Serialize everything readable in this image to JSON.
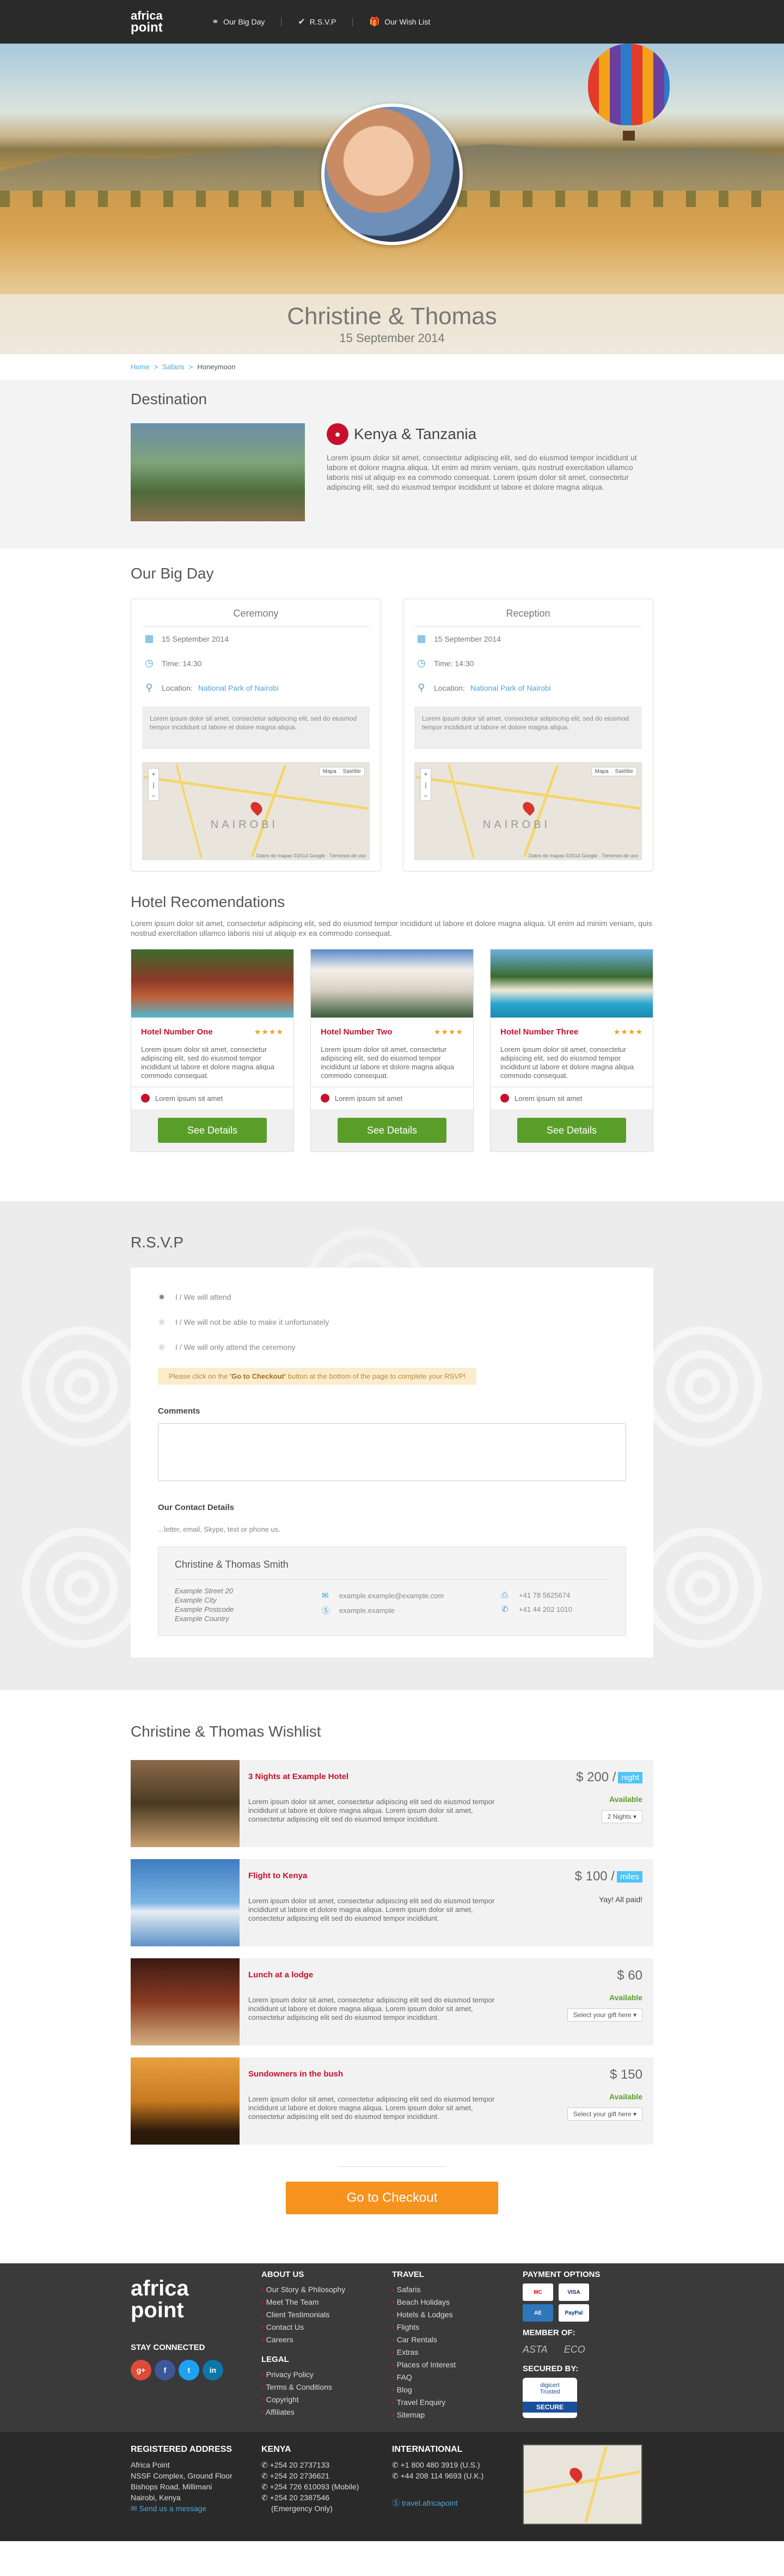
{
  "nav": {
    "logo_line1": "africa",
    "logo_line2": "point",
    "links": [
      {
        "label": "Our Big Day",
        "icon": "rings-icon"
      },
      {
        "label": "R.S.V.P",
        "icon": "check-circle-icon"
      },
      {
        "label": "Our Wish List",
        "icon": "gift-icon"
      }
    ]
  },
  "hero": {
    "couple": "Christine & Thomas",
    "date": "15 September 2014"
  },
  "breadcrumb": [
    "Home",
    "Safaris",
    "Honeymoon"
  ],
  "destination": {
    "section_title": "Destination",
    "name": "Kenya & Tanzania",
    "text": "Lorem ipsum dolor sit amet, consectetur adipiscing elit, sed do eiusmod tempor incididunt ut labore et dolore magna aliqua. Ut enim ad minim veniam, quis nostrud exercitation ullamco laboris nisi ut aliquip ex ea commodo consequat. Lorem ipsum dolor sit amet, consectetur adipiscing elit, sed do eiusmod tempor incididunt ut labore et dolore magna aliqua."
  },
  "bigday": {
    "section_title": "Our Big Day",
    "events": [
      {
        "title": "Ceremony",
        "date": "15 September 2014",
        "time": "Time: 14:30",
        "location_label": "Location:",
        "location": "National Park of Nairobi",
        "desc": "Lorem ipsum dolor sit amet, consectetur adipiscing elit, sed do eiusmod tempor incididunt ut labore et dolore magna aliqua.",
        "map_label": "NAIROBI",
        "map_types": [
          "Mapa",
          "Satélite"
        ],
        "map_footer": "Datos de mapas ©2014 Google · Términos de uso"
      },
      {
        "title": "Reception",
        "date": "15 September 2014",
        "time": "Time: 14:30",
        "location_label": "Location:",
        "location": "National Park of Nairobi",
        "desc": "Lorem ipsum dolor sit amet, consectetur adipiscing elit, sed do eiusmod tempor incididunt ut labore et dolore magna aliqua.",
        "map_label": "NAIROBI",
        "map_types": [
          "Mapa",
          "Satélite"
        ],
        "map_footer": "Datos de mapas ©2014 Google · Términos de uso"
      }
    ]
  },
  "hotels": {
    "section_title": "Hotel Recomendations",
    "intro": "Lorem ipsum dolor sit amet, consectetur adipiscing elit, sed do eiusmod tempor incididunt ut labore et dolore magna aliqua. Ut enim ad minim veniam, quis nostrud exercitation ullamco laboris nisi ut aliquip ex ea commodo consequat.",
    "items": [
      {
        "name": "Hotel Number One",
        "stars": "★★★★",
        "desc": "Lorem ipsum dolor sit amet, consectetur adipiscing elit, sed do eiusmod tempor incididunt ut labore et dolore magna aliqua commodo consequat.",
        "location": "Lorem ipsum sit amet",
        "button": "See Details",
        "img_color": "#7a3b2a"
      },
      {
        "name": "Hotel Number Two",
        "stars": "★★★★",
        "desc": "Lorem ipsum dolor sit amet, consectetur adipiscing elit, sed do eiusmod tempor incididunt ut labore et dolore magna aliqua commodo consequat.",
        "location": "Lorem ipsum sit amet",
        "button": "See Details",
        "img_color": "#e8e4dc"
      },
      {
        "name": "Hotel Number Three",
        "stars": "★★★★",
        "desc": "Lorem ipsum dolor sit amet, consectetur adipiscing elit, sed do eiusmod tempor incididunt ut labore et dolore magna aliqua commodo consequat.",
        "location": "Lorem ipsum sit amet",
        "button": "See Details",
        "img_color": "#3fa6c8"
      }
    ]
  },
  "rsvp": {
    "section_title": "R.S.V.P",
    "options": [
      "I / We will attend",
      "I / We will not be able to make it unfortunately",
      "I / We will only attend the ceremony"
    ],
    "note_before": "Please click on the ",
    "note_bold": "'Go to Checkout'",
    "note_after": " button at the bottom of the page to complete your RSVP!",
    "comments_label": "Comments",
    "contact_label": "Our Contact Details",
    "contact_hint": "...letter, email, Skype, text or phone us.",
    "contact_name": "Christine & Thomas Smith",
    "address": [
      "Example Street 20",
      "Example City",
      "Example Postcode",
      "Example Country"
    ],
    "email": "example.example@example.com",
    "skype": "example.example",
    "fax": "+41 78 5625674",
    "phone": "+41 44 202 1010"
  },
  "wishlist": {
    "section_title": "Christine & Thomas Wishlist",
    "items": [
      {
        "title": "3 Nights at Example Hotel",
        "price": "$ 200 /",
        "unit": "night",
        "status": "Available",
        "select": "2 Nights",
        "desc": "Lorem ipsum dolor sit amet, consectetur adipiscing elit sed do eiusmod tempor incididunt ut labore et dolore magna aliqua. Lorem ipsum dolor sit amet, consectetur adipiscing elit sed do eiusmod tempor incididunt.",
        "img_color": "#6b4a2a"
      },
      {
        "title": "Flight to Kenya",
        "price": "$ 100 /",
        "unit": "miles",
        "status": "Yay! All paid!",
        "select": "",
        "desc": "Lorem ipsum dolor sit amet, consectetur adipiscing elit sed do eiusmod tempor incididunt ut labore et dolore magna aliqua. Lorem ipsum dolor sit amet, consectetur adipiscing elit sed do eiusmod tempor incididunt.",
        "img_color": "#4a8ec8"
      },
      {
        "title": "Lunch at a lodge",
        "price": "$ 60",
        "unit": "",
        "status": "Available",
        "select": "Select your gift here",
        "desc": "Lorem ipsum dolor sit amet, consectetur adipiscing elit sed do eiusmod tempor incididunt ut labore et dolore magna aliqua. Lorem ipsum dolor sit amet, consectetur adipiscing elit sed do eiusmod tempor incididunt.",
        "img_color": "#6e2a1e"
      },
      {
        "title": "Sundowners in the bush",
        "price": "$ 150",
        "unit": "",
        "status": "Available",
        "select": "Select your gift here",
        "desc": "Lorem ipsum dolor sit amet, consectetur adipiscing elit sed do eiusmod tempor incididunt ut labore et dolore magna aliqua. Lorem ipsum dolor sit amet, consectetur adipiscing elit sed do eiusmod tempor incididunt.",
        "img_color": "#c88a2a"
      }
    ],
    "checkout": "Go to Checkout"
  },
  "footer": {
    "logo_line1": "africa",
    "logo_line2": "point",
    "stay_connected": "STAY CONNECTED",
    "social": [
      "g+",
      "f",
      "t",
      "in"
    ],
    "about_head": "ABOUT US",
    "about": [
      "Our Story & Philosophy",
      "Meet The Team",
      "Client Testimonials",
      "Contact Us",
      "Careers"
    ],
    "legal_head": "LEGAL",
    "legal": [
      "Privacy Policy",
      "Terms & Conditions",
      "Copyright",
      "Affiliates"
    ],
    "travel_head": "TRAVEL",
    "travel": [
      "Safaris",
      "Beach Holidays",
      "Hotels & Lodges",
      "Flights",
      "Car Rentals",
      "Extras",
      "Places of Interest",
      "FAQ",
      "Blog",
      "Travel Enquiry",
      "Sitemap"
    ],
    "payment_head": "PAYMENT OPTIONS",
    "payments": [
      "MC",
      "VISA",
      "AE",
      "PayPal"
    ],
    "member_head": "MEMBER OF:",
    "members": [
      "ASTA",
      "ECO"
    ],
    "secured_head": "SECURED BY:",
    "secured_brand": "digicert",
    "secured_sub": "Trusted",
    "secured_bar": "SECURE"
  },
  "bottom": {
    "reg_head": "REGISTERED ADDRESS",
    "reg": [
      "Africa Point",
      "NSSF Complex, Ground Floor",
      "Bishops Road, Millimani",
      "Nairobi, Kenya"
    ],
    "reg_link": "Send us a message",
    "kenya_head": "KENYA",
    "kenya": [
      "+254 20 2737133",
      "+254 20 2736621",
      "+254 726 610093 (Mobile)",
      "+254 20 2387546",
      "(Emergency Only)"
    ],
    "intl_head": "INTERNATIONAL",
    "intl": [
      "+1 800 480 3919 (U.S.)",
      "+44 208 114 9693 (U.K.)"
    ],
    "intl_link": "travel.africapoint"
  }
}
